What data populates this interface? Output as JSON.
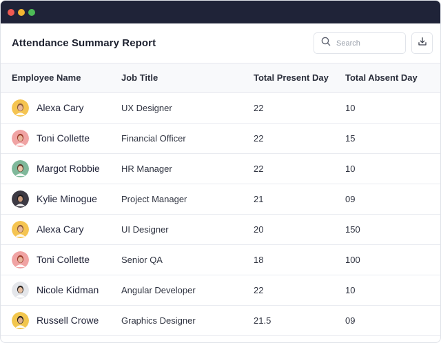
{
  "window": {
    "controls": [
      "close",
      "minimize",
      "maximize"
    ],
    "colors": {
      "titlebar": "#1f2338",
      "close": "#ee5a52",
      "minimize": "#f2b632",
      "maximize": "#4dbb57"
    }
  },
  "header": {
    "title": "Attendance Summary Report",
    "search_placeholder": "Search",
    "search_icon": "search-icon",
    "download_icon": "download-icon"
  },
  "table": {
    "columns": [
      "Employee Name",
      "Job Title",
      "Total Present Day",
      "Total Absent Day"
    ],
    "rows": [
      {
        "name": "Alexa Cary",
        "job": "UX Designer",
        "present": "22",
        "absent": "10",
        "avatar": {
          "bg": "#f5c451",
          "skin": "#e8b89a",
          "hair": "#8a5a3b"
        }
      },
      {
        "name": "Toni Collette",
        "job": "Financial Officer",
        "present": "22",
        "absent": "15",
        "avatar": {
          "bg": "#f0a3a3",
          "skin": "#e6b49a",
          "hair": "#9b3b2a"
        }
      },
      {
        "name": "Margot Robbie",
        "job": "HR Manager",
        "present": "22",
        "absent": "10",
        "avatar": {
          "bg": "#7fb89a",
          "skin": "#e9c2a6",
          "hair": "#5a3a28"
        }
      },
      {
        "name": "Kylie Minogue",
        "job": "Project Manager",
        "present": "21",
        "absent": "09",
        "avatar": {
          "bg": "#3d3a44",
          "skin": "#c99a7c",
          "hair": "#1e1b1f"
        }
      },
      {
        "name": "Alexa Cary",
        "job": "UI Designer",
        "present": "20",
        "absent": "150",
        "avatar": {
          "bg": "#f5c451",
          "skin": "#e8b89a",
          "hair": "#8a5a3b"
        }
      },
      {
        "name": "Toni Collette",
        "job": "Senior QA",
        "present": "18",
        "absent": "100",
        "avatar": {
          "bg": "#f0a3a3",
          "skin": "#e6b49a",
          "hair": "#9b3b2a"
        }
      },
      {
        "name": "Nicole Kidman",
        "job": "Angular Developer",
        "present": "22",
        "absent": "10",
        "avatar": {
          "bg": "#e4e6ea",
          "skin": "#e6bfa2",
          "hair": "#2a2624"
        }
      },
      {
        "name": "Russell Crowe",
        "job": "Graphics Designer",
        "present": "21.5",
        "absent": "09",
        "avatar": {
          "bg": "#f2c64e",
          "skin": "#dcae8e",
          "hair": "#2b2320"
        }
      }
    ]
  }
}
